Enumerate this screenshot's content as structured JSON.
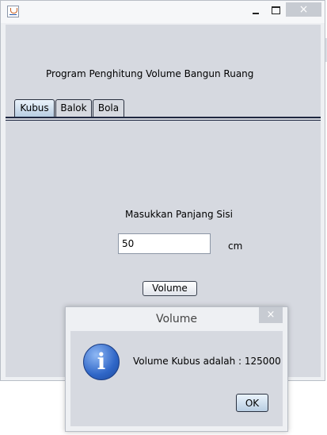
{
  "window": {
    "close_symbol": "×",
    "app_title": "Program Penghitung Volume Bangun Ruang",
    "tabs": [
      {
        "label": "Kubus",
        "active": true
      },
      {
        "label": "Balok",
        "active": false
      },
      {
        "label": "Bola",
        "active": false
      }
    ],
    "prompt_label": "Masukkan Panjang Sisi",
    "length_input": {
      "value": "50"
    },
    "unit_label": "cm",
    "volume_button": "Volume"
  },
  "dialog": {
    "title": "Volume",
    "close_symbol": "×",
    "icon": "info-icon",
    "icon_glyph": "i",
    "message": "Volume Kubus adalah : 125000",
    "ok_button": "OK"
  },
  "colors": {
    "panel_bg": "#d6d9e0",
    "window_bg": "#eef0f3",
    "selected_tab": "#b8cde2",
    "info_icon_blue": "#2f66c7"
  }
}
